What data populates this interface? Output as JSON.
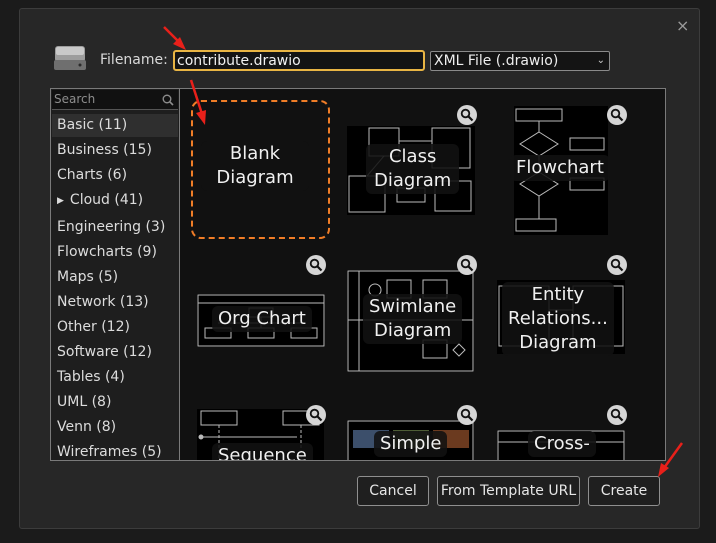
{
  "dialog": {
    "close_glyph": "×",
    "filename_label": "Filename:",
    "filename_value": "contribute.drawio",
    "file_type_selected": "XML File (.drawio)",
    "search_placeholder": "Search"
  },
  "categories": [
    {
      "label": "Basic (11)",
      "selected": true
    },
    {
      "label": "Business (15)"
    },
    {
      "label": "Charts (6)"
    },
    {
      "label": "Cloud (41)",
      "expandable": true
    },
    {
      "label": "Engineering (3)"
    },
    {
      "label": "Flowcharts (9)"
    },
    {
      "label": "Maps (5)"
    },
    {
      "label": "Network (13)"
    },
    {
      "label": "Other (12)"
    },
    {
      "label": "Software (12)"
    },
    {
      "label": "Tables (4)"
    },
    {
      "label": "UML (8)"
    },
    {
      "label": "Venn (8)"
    },
    {
      "label": "Wireframes (5)"
    }
  ],
  "templates": [
    {
      "label": "Blank\nDiagram",
      "selected": true
    },
    {
      "label": "Class\nDiagram"
    },
    {
      "label": "Flowchart"
    },
    {
      "label": "Org Chart"
    },
    {
      "label": "Swimlane\nDiagram"
    },
    {
      "label": "Entity\nRelations...\nDiagram"
    },
    {
      "label": "Sequence"
    },
    {
      "label": "Simple"
    },
    {
      "label": "Cross-"
    }
  ],
  "buttons": {
    "cancel": "Cancel",
    "from_template_url": "From Template URL",
    "create": "Create"
  },
  "colors": {
    "selection_outline": "#f07d27",
    "input_focus": "#e9b544",
    "annotation_arrow": "#e8201a"
  }
}
